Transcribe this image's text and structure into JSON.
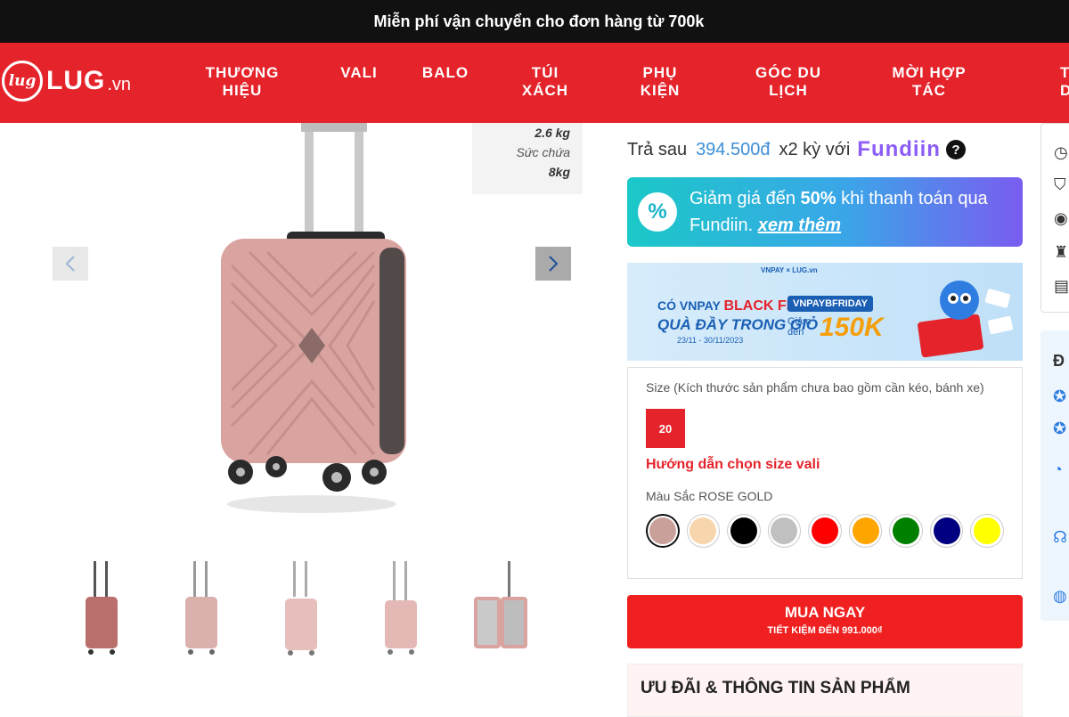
{
  "announcement": "Miễn phí vận chuyển cho đơn hàng từ 700k",
  "logo": {
    "mark": "lug",
    "brand": "LUG",
    "tld": ".vn"
  },
  "nav": [
    "THƯƠNG\nHIỆU",
    "VALI",
    "BALO",
    "TÚI\nXÁCH",
    "PHỤ\nKIỆN",
    "GÓC DU\nLỊCH",
    "MỜI HỢP\nTÁC",
    "TUY\nDỤ"
  ],
  "spec": {
    "weight_value": "2.6 kg",
    "capacity_label": "Sức chứa",
    "capacity_value": "8kg"
  },
  "paylater": {
    "prefix": "Trả sau",
    "price": "394.500đ",
    "suffix": "x2 kỳ với",
    "provider": "Fundiin",
    "help": "?"
  },
  "promo": {
    "text_before": "Giảm giá đến ",
    "percent": "50%",
    "text_after": " khi thanh toán qua Fundiin.",
    "link": "xem thêm"
  },
  "banner": {
    "top": "VNPAY × LUG.vn",
    "row1_prefix": "CÓ VNPAY",
    "row1_bf": "BLACK FRIDAY",
    "row2": "QUÀ ĐẦY TRONG GIỎ",
    "dates": "23/11 - 30/11/2023",
    "code": "VNPAYBFRIDAY",
    "discount_label": "Giảm\nđến",
    "amount": "150K"
  },
  "options": {
    "size_label": "Size (Kích thước sản phẩm chưa bao gồm cần kéo, bánh xe)",
    "size_value": "20",
    "size_guide": "Hướng dẫn chọn size vali",
    "color_label": "Màu Sắc",
    "color_value": "ROSE GOLD",
    "swatches": [
      "#c9a09a",
      "#f7d6ae",
      "#000000",
      "#c0c0c0",
      "#ff0000",
      "#ffa500",
      "#008000",
      "#000080",
      "#ffff00"
    ]
  },
  "buy": {
    "label": "MUA NGAY",
    "sub": "TIẾT KIỆM ĐẾN 991.000₫"
  },
  "offers_title": "ƯU ĐÃI & THÔNG TIN SẢN PHẨM",
  "colors": {
    "brand_red": "#e5232a",
    "topbar": "#111111",
    "suitcase": "#d9a4a0"
  }
}
